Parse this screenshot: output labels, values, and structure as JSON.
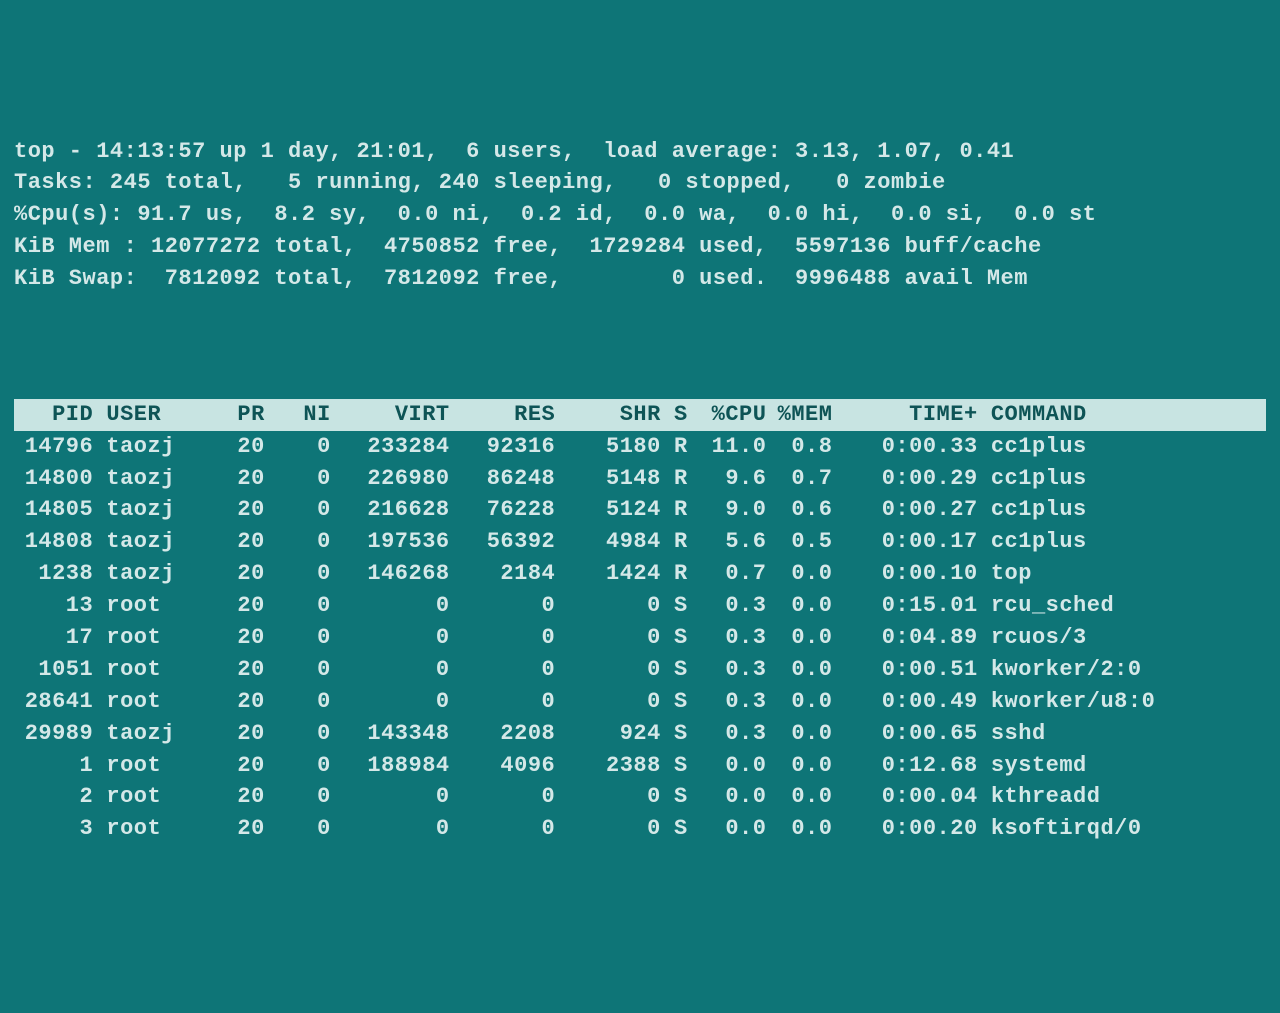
{
  "summary": {
    "time": "14:13:57",
    "uptime": "1 day, 21:01",
    "users": "6",
    "load": "3.13, 1.07, 0.41",
    "tasks": {
      "total": "245",
      "running": "5",
      "sleeping": "240",
      "stopped": "0",
      "zombie": "0"
    },
    "cpu": {
      "us": "91.7",
      "sy": "8.2",
      "ni": "0.0",
      "id": "0.2",
      "wa": "0.0",
      "hi": "0.0",
      "si": "0.0",
      "st": "0.0"
    },
    "mem": {
      "total": "12077272",
      "free": "4750852",
      "used": "1729284",
      "buff": "5597136"
    },
    "swap": {
      "total": "7812092",
      "free": "7812092",
      "used": "0",
      "avail": "9996488"
    }
  },
  "headers": [
    "PID",
    "USER",
    "PR",
    "NI",
    "VIRT",
    "RES",
    "SHR",
    "S",
    "%CPU",
    "%MEM",
    "TIME+",
    "COMMAND"
  ],
  "processes": [
    {
      "pid": "14796",
      "user": "taozj",
      "pr": "20",
      "ni": "0",
      "virt": "233284",
      "res": "92316",
      "shr": "5180",
      "s": "R",
      "cpu": "11.0",
      "mem": "0.8",
      "time": "0:00.33",
      "cmd": "cc1plus"
    },
    {
      "pid": "14800",
      "user": "taozj",
      "pr": "20",
      "ni": "0",
      "virt": "226980",
      "res": "86248",
      "shr": "5148",
      "s": "R",
      "cpu": "9.6",
      "mem": "0.7",
      "time": "0:00.29",
      "cmd": "cc1plus"
    },
    {
      "pid": "14805",
      "user": "taozj",
      "pr": "20",
      "ni": "0",
      "virt": "216628",
      "res": "76228",
      "shr": "5124",
      "s": "R",
      "cpu": "9.0",
      "mem": "0.6",
      "time": "0:00.27",
      "cmd": "cc1plus"
    },
    {
      "pid": "14808",
      "user": "taozj",
      "pr": "20",
      "ni": "0",
      "virt": "197536",
      "res": "56392",
      "shr": "4984",
      "s": "R",
      "cpu": "5.6",
      "mem": "0.5",
      "time": "0:00.17",
      "cmd": "cc1plus"
    },
    {
      "pid": "1238",
      "user": "taozj",
      "pr": "20",
      "ni": "0",
      "virt": "146268",
      "res": "2184",
      "shr": "1424",
      "s": "R",
      "cpu": "0.7",
      "mem": "0.0",
      "time": "0:00.10",
      "cmd": "top"
    },
    {
      "pid": "13",
      "user": "root",
      "pr": "20",
      "ni": "0",
      "virt": "0",
      "res": "0",
      "shr": "0",
      "s": "S",
      "cpu": "0.3",
      "mem": "0.0",
      "time": "0:15.01",
      "cmd": "rcu_sched"
    },
    {
      "pid": "17",
      "user": "root",
      "pr": "20",
      "ni": "0",
      "virt": "0",
      "res": "0",
      "shr": "0",
      "s": "S",
      "cpu": "0.3",
      "mem": "0.0",
      "time": "0:04.89",
      "cmd": "rcuos/3"
    },
    {
      "pid": "1051",
      "user": "root",
      "pr": "20",
      "ni": "0",
      "virt": "0",
      "res": "0",
      "shr": "0",
      "s": "S",
      "cpu": "0.3",
      "mem": "0.0",
      "time": "0:00.51",
      "cmd": "kworker/2:0"
    },
    {
      "pid": "28641",
      "user": "root",
      "pr": "20",
      "ni": "0",
      "virt": "0",
      "res": "0",
      "shr": "0",
      "s": "S",
      "cpu": "0.3",
      "mem": "0.0",
      "time": "0:00.49",
      "cmd": "kworker/u8:0"
    },
    {
      "pid": "29989",
      "user": "taozj",
      "pr": "20",
      "ni": "0",
      "virt": "143348",
      "res": "2208",
      "shr": "924",
      "s": "S",
      "cpu": "0.3",
      "mem": "0.0",
      "time": "0:00.65",
      "cmd": "sshd"
    },
    {
      "pid": "1",
      "user": "root",
      "pr": "20",
      "ni": "0",
      "virt": "188984",
      "res": "4096",
      "shr": "2388",
      "s": "S",
      "cpu": "0.0",
      "mem": "0.0",
      "time": "0:12.68",
      "cmd": "systemd"
    },
    {
      "pid": "2",
      "user": "root",
      "pr": "20",
      "ni": "0",
      "virt": "0",
      "res": "0",
      "shr": "0",
      "s": "S",
      "cpu": "0.0",
      "mem": "0.0",
      "time": "0:00.04",
      "cmd": "kthreadd"
    },
    {
      "pid": "3",
      "user": "root",
      "pr": "20",
      "ni": "0",
      "virt": "0",
      "res": "0",
      "shr": "0",
      "s": "S",
      "cpu": "0.0",
      "mem": "0.0",
      "time": "0:00.20",
      "cmd": "ksoftirqd/0"
    }
  ]
}
